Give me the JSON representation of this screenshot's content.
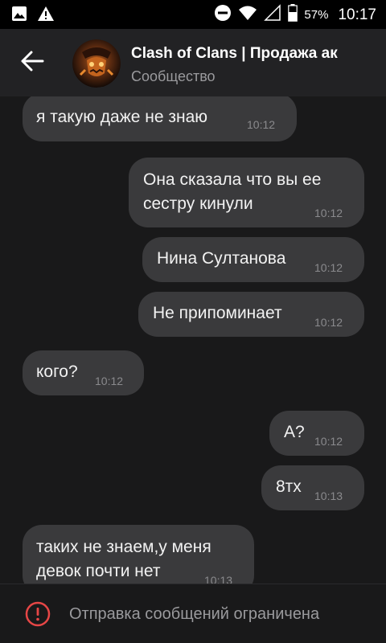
{
  "status_bar": {
    "battery_percent": "57%",
    "time": "10:17",
    "icons": [
      "image-icon",
      "alert-icon",
      "do-not-disturb-icon",
      "wifi-icon",
      "signal-icon",
      "battery-icon"
    ]
  },
  "header": {
    "back_icon": "arrow-left-icon",
    "title": "Clash of Clans | Продажа ак",
    "subtitle": "Сообщество"
  },
  "messages": [
    {
      "direction": "in",
      "lines": [
        "я такую даже не знаю"
      ],
      "time": "10:12"
    },
    {
      "direction": "out",
      "lines": [
        "Она сказала что вы ее",
        "сестру кинули"
      ],
      "time": "10:12"
    },
    {
      "direction": "out",
      "lines": [
        "Нина Султанова"
      ],
      "time": "10:12"
    },
    {
      "direction": "out",
      "lines": [
        "Не припоминает"
      ],
      "time": "10:12"
    },
    {
      "direction": "in",
      "lines": [
        "кого?"
      ],
      "time": "10:12"
    },
    {
      "direction": "out",
      "lines": [
        "А?"
      ],
      "time": "10:12"
    },
    {
      "direction": "out",
      "lines": [
        "8тх"
      ],
      "time": "10:13"
    },
    {
      "direction": "in",
      "lines": [
        "таких не знаем,у меня",
        "девок почти нет"
      ],
      "time": "10:13"
    }
  ],
  "footer": {
    "icon": "warning-circle-icon",
    "restricted_text": "Отправка сообщений ограничена"
  },
  "colors": {
    "background": "#19191a",
    "header": "#222224",
    "bubble": "#3a3a3c",
    "warning_icon": "#e64646"
  }
}
